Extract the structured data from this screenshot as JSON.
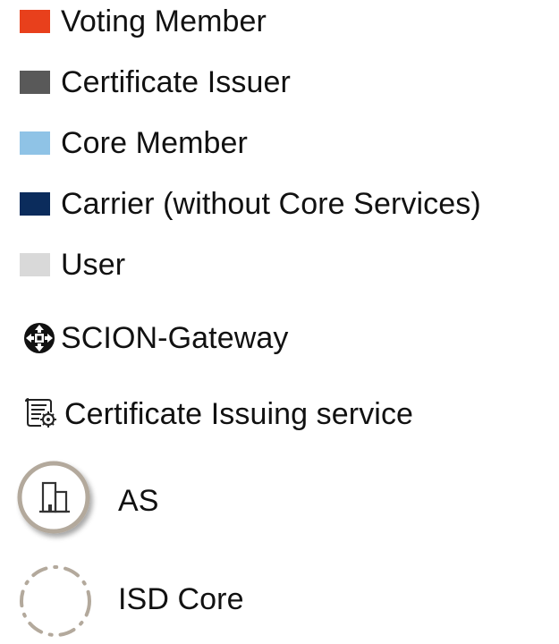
{
  "legend": {
    "items": [
      {
        "label": "Voting Member",
        "color": "#e8401c"
      },
      {
        "label": "Certificate Issuer",
        "color": "#595959"
      },
      {
        "label": "Core Member",
        "color": "#8fc3e6"
      },
      {
        "label": "Carrier (without Core Services)",
        "color": "#0b2c5c"
      },
      {
        "label": "User",
        "color": "#d9d9d9"
      }
    ],
    "symbols": [
      {
        "label": "SCION-Gateway",
        "icon": "gateway-icon"
      },
      {
        "label": "Certificate Issuing service",
        "icon": "certificate-icon"
      },
      {
        "label": "AS",
        "icon": "as-building-icon"
      },
      {
        "label": "ISD Core",
        "icon": "dashed-circle-icon"
      }
    ]
  }
}
